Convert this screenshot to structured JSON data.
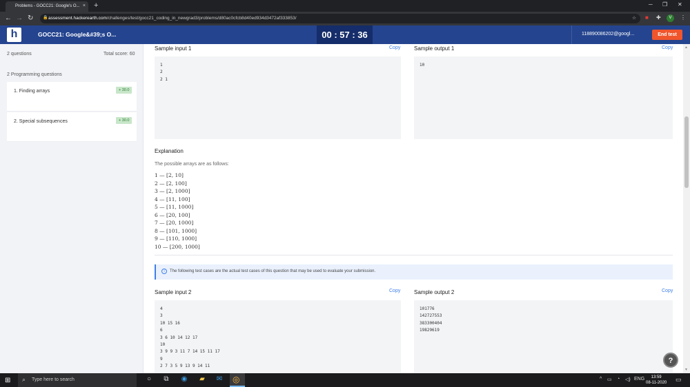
{
  "browser": {
    "tab_title": "Problems - GOCC21: Google's O...",
    "tab_close": "×",
    "new_tab": "+",
    "url_host": "assessment.hackerearth.com",
    "url_path": "/challenges/test/gocc21_coding_in_newgrad3/problems/d80ac0cfcb8d40ed934d3472af333853/",
    "profile_initial": "V"
  },
  "header": {
    "logo": "h",
    "title": "GOCC21: Google&#39;s O...",
    "timer": "00 : 57 : 36",
    "user_email": "118890086202@googl...",
    "end_test_label": "End test"
  },
  "sidebar": {
    "question_count": "2 questions",
    "total_score": "Total score: 60",
    "section_label": "2 Programming questions",
    "questions": [
      {
        "label": "1.  Finding arrays",
        "score": "+ 30.0"
      },
      {
        "label": "2.  Special subsequences",
        "score": "+ 30.0"
      }
    ]
  },
  "main": {
    "sample_input_1": {
      "label": "Sample input 1",
      "copy": "Copy",
      "lines": [
        "1",
        "2",
        "2 1"
      ]
    },
    "sample_output_1": {
      "label": "Sample output 1",
      "copy": "Copy",
      "lines": [
        "10"
      ]
    },
    "explanation": {
      "title": "Explanation",
      "intro": "The possible arrays are as follows:",
      "items": [
        "1 — [2, 10]",
        "2 — [2, 100]",
        "3 — [2, 1000]",
        "4 — [11, 100]",
        "5 — [11, 1000]",
        "6 — [20, 100]",
        "7 — [20, 1000]",
        "8 — [101, 1000]",
        "9 — [110, 1000]",
        "10 — [200, 1000]"
      ]
    },
    "info_text": "The following test cases are the actual test cases of this question that may be used to evaluate your submission.",
    "sample_input_2": {
      "label": "Sample input 2",
      "copy": "Copy",
      "lines": [
        "4",
        "3",
        "10 15 16",
        "6",
        "3 6 10 14 12 17",
        "10",
        "3 9 9 3 11 7 14 15 11 17",
        "9",
        "2 7 3 5 9 13 9 14 11"
      ]
    },
    "sample_output_2": {
      "label": "Sample output 2",
      "copy": "Copy",
      "lines": [
        "101776",
        "142727553",
        "383300404",
        "19829619"
      ]
    },
    "help": "?"
  },
  "taskbar": {
    "search_placeholder": "Type here to search",
    "language": "ENG",
    "time": "13:59",
    "date": "08-11-2020"
  }
}
